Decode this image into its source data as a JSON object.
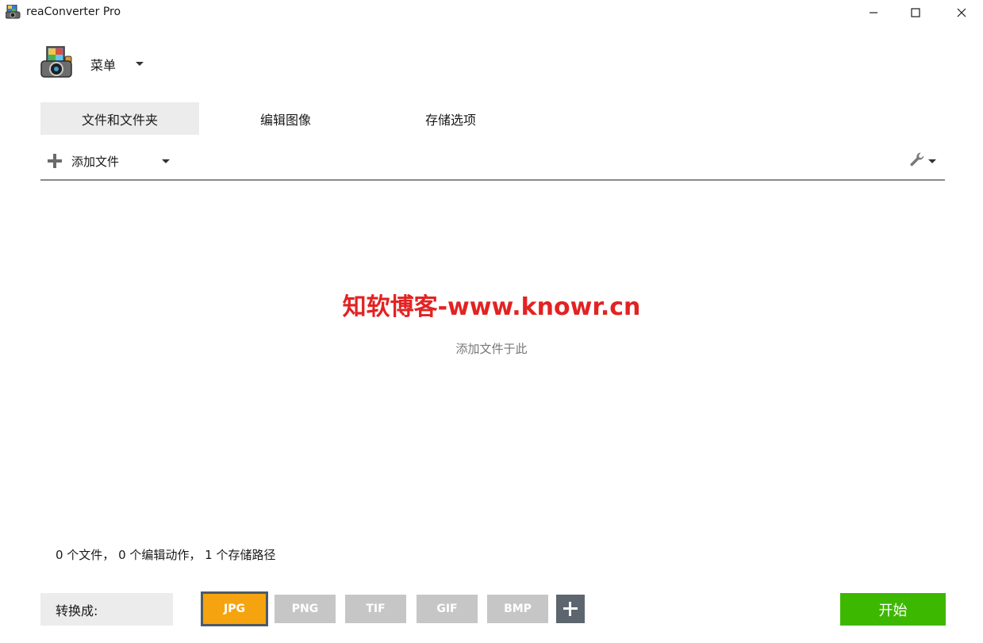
{
  "window": {
    "title": "reaConverter Pro"
  },
  "menu": {
    "label": "菜单"
  },
  "tabs": [
    {
      "label": "文件和文件夹",
      "active": true
    },
    {
      "label": "编辑图像",
      "active": false
    },
    {
      "label": "存储选项",
      "active": false
    }
  ],
  "toolbar": {
    "add_files_label": "添加文件",
    "settings_icon": "wrench-icon"
  },
  "dropzone": {
    "watermark": "知软博客-www.knowr.cn",
    "hint": "添加文件于此"
  },
  "status": {
    "text": "0 个文件， 0 个编辑动作， 1 个存储路径"
  },
  "bottom": {
    "convert_label": "转换成:",
    "formats": [
      {
        "label": "JPG",
        "selected": true
      },
      {
        "label": "PNG",
        "selected": false
      },
      {
        "label": "TIF",
        "selected": false
      },
      {
        "label": "GIF",
        "selected": false
      },
      {
        "label": "BMP",
        "selected": false
      }
    ],
    "start_label": "开始"
  },
  "colors": {
    "accent_selected_format": "#f5a40f",
    "start_button": "#3db800",
    "watermark": "#e32222"
  }
}
